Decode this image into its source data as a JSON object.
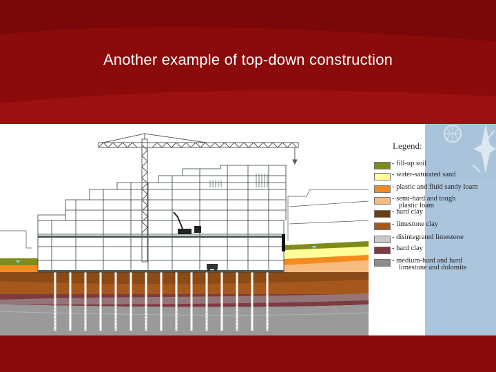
{
  "slide": {
    "title": "Another example of top-down construction"
  },
  "legend": {
    "title": "Legend:",
    "items": [
      {
        "label": "- fill-up soil",
        "sub": "",
        "color": "#7f8b1a"
      },
      {
        "label": "- water-saturated sand",
        "sub": "",
        "color": "#ffff99"
      },
      {
        "label": "- plastic and fluid sandy loam",
        "sub": "",
        "color": "#f58a1f"
      },
      {
        "label": "- semi-hard and tough",
        "sub": "plastic loam",
        "color": "#f7bb80"
      },
      {
        "label": "- hard clay",
        "sub": "",
        "color": "#6b3d12"
      },
      {
        "label": "- limestone clay",
        "sub": "",
        "color": "#a6581c"
      },
      {
        "label": "- disintegrated limestone",
        "sub": "",
        "color": "#c9c9c9"
      },
      {
        "label": "- hard clay",
        "sub": "",
        "color": "#7d3b41"
      },
      {
        "label": "- medium-hard and hard",
        "sub": "limestone and dolomite",
        "color": "#8c8c8c"
      }
    ]
  },
  "colors": {
    "slide_background": "#8b0a0a",
    "slide_band": "#9c1010",
    "title_text": "#ffffff",
    "figure_background": "#ffffff",
    "corner_panel": "#a9c3db",
    "structure_lines": "#2a3a3a",
    "crane": "#5a5a5a",
    "piles": "#ffffff"
  }
}
